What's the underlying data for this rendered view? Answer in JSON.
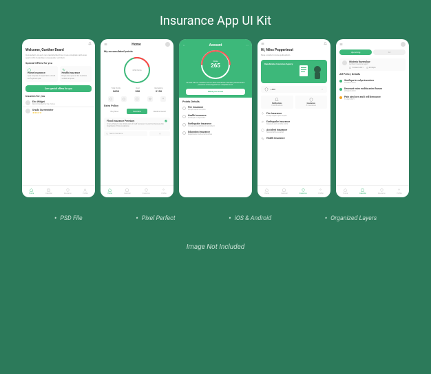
{
  "title": "Insurance App UI Kit",
  "features": [
    "PSD File",
    "Pixel Perfect",
    "iOS & Android",
    "Organized Layers"
  ],
  "footer": "Image Not Included",
  "nav": {
    "home": "Home",
    "calendar": "Calendar",
    "insurance": "Insurance",
    "profile": "Profile"
  },
  "screen1": {
    "welcome": "Welcome, Gunther Beard",
    "subtext": "Quis autem vel eum iure reprehenderit qui in ea voluptate velit esse quam nihil molestiae consequatur vel illum.",
    "specialLabel": "Special Offers for you",
    "cards": [
      {
        "title": "Home Insurance",
        "text": "Quia voluptas sit aspernatur aut odit aut fugit sed quia."
      },
      {
        "title": "Health Insurance",
        "text": "Eaque iosa quae ab illo inventore veritatis et quasi."
      }
    ],
    "banner": "See special offers for you",
    "insurersLabel": "Insurers for you",
    "insurers": [
      {
        "name": "Eric Widget",
        "sub": "Recommended by the chance"
      },
      {
        "name": "Ursula Gurnmeister",
        "sub": ""
      }
    ]
  },
  "screen2": {
    "title": "Home",
    "pointsLabel": "My accumulated points",
    "pointsStats": [
      {
        "label": "Total Points",
        "val": "2650"
      },
      {
        "label": "Used",
        "val": "500"
      },
      {
        "label": "Remaining",
        "val": "2150"
      }
    ],
    "circleLabel": "2650 Points",
    "extraLabel": "Extra Policy",
    "tabs": [
      "Buy Now",
      "Examine",
      "Medical Lead"
    ],
    "policy": {
      "title": "Flood Insurance Premium",
      "text": "Or any others to due obtain pain of itself because it is pain but because the magnitude of the acceptance."
    },
    "searchText": "Search Insurance"
  },
  "screen3": {
    "title": "Account",
    "scoreLabel": "Whole",
    "scoreValue": "265",
    "subtext": "Et iusto odio ac cusantium ut non ullam doloresaue maiohum placeat facere possimus omnis dignissimos voluptates sunt.",
    "raiseBtn": "Raise your score",
    "detailsLabel": "Points Details",
    "items": [
      {
        "title": "Fire Insurance",
        "sub": "Except sapien tempora"
      },
      {
        "title": "Health Insurance",
        "sub": "Similique in aspernatur"
      },
      {
        "title": "Earthquake Insurance",
        "sub": "Occaecati cupiditate non provident"
      },
      {
        "title": "Education Insurance",
        "sub": "Repellendus facitus temporibus"
      }
    ]
  },
  "screen4": {
    "greeting": "Hi, Niles Peppertrout",
    "subtext": "Esse voluitum dolce quibusdam",
    "heroText": "Repellendus Insurance Agency",
    "heroSub": "+400",
    "cats": [
      {
        "label": "Notifications",
        "count": "3 Notifications"
      },
      {
        "label": "Insurances",
        "count": "8 Insurances"
      }
    ],
    "items": [
      {
        "title": "Fire Insurance",
        "sub": "Except sapien quas aspern"
      },
      {
        "title": "Earthquake Insurance",
        "sub": "Deserunt enim molitis animi"
      },
      {
        "title": "Accident Insurance",
        "sub": "Necessitatibus eveniet"
      },
      {
        "title": "Health Insurance",
        "sub": ""
      }
    ]
  },
  "screen5": {
    "tabs": [
      "Upcoming",
      "All"
    ],
    "agent": {
      "name": "Wisteria Ravenclaw",
      "role": "Gunther Insurance Agent",
      "date": "19 March 2021",
      "time": "05:30pm"
    },
    "allLabel": "All Policy Details",
    "items": [
      {
        "date": "16 March 2021",
        "text": "Similique in culpa inventore",
        "color": "green"
      },
      {
        "date": "23 March 2021",
        "text": "Deserunt enim molitis animi harum",
        "color": "green"
      },
      {
        "date": "12 April 2021",
        "text": "Pain aim born and I will denounce",
        "color": "orange"
      }
    ]
  }
}
